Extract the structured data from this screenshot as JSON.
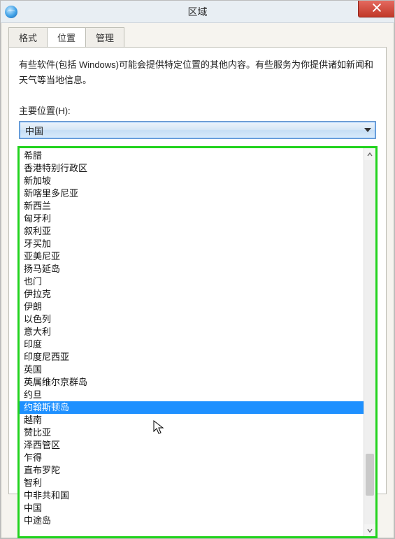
{
  "titlebar": {
    "title": "区域"
  },
  "tabs": {
    "format": "格式",
    "location": "位置",
    "admin": "管理"
  },
  "panel": {
    "description": "有些软件(包括 Windows)可能会提供特定位置的其他内容。有些服务为你提供诸如新闻和天气等当地信息。",
    "label": "主要位置(H):"
  },
  "combo": {
    "selected": "中国"
  },
  "dropdown": {
    "selected_index": 20,
    "items": [
      "希腊",
      "香港特别行政区",
      "新加坡",
      "新喀里多尼亚",
      "新西兰",
      "匈牙利",
      "叙利亚",
      "牙买加",
      "亚美尼亚",
      "扬马延岛",
      "也门",
      "伊拉克",
      "伊朗",
      "以色列",
      "意大利",
      "印度",
      "印度尼西亚",
      "英国",
      "英属维尔京群岛",
      "约旦",
      "约翰斯顿岛",
      "越南",
      "赞比亚",
      "泽西管区",
      "乍得",
      "直布罗陀",
      "智利",
      "中非共和国",
      "中国",
      "中途岛"
    ]
  },
  "icons": {
    "globe": "globe-icon",
    "close": "close-icon",
    "caret": "chevron-down-icon",
    "up": "chevron-up-icon",
    "down": "chevron-down-icon",
    "cursor": "cursor-icon"
  }
}
